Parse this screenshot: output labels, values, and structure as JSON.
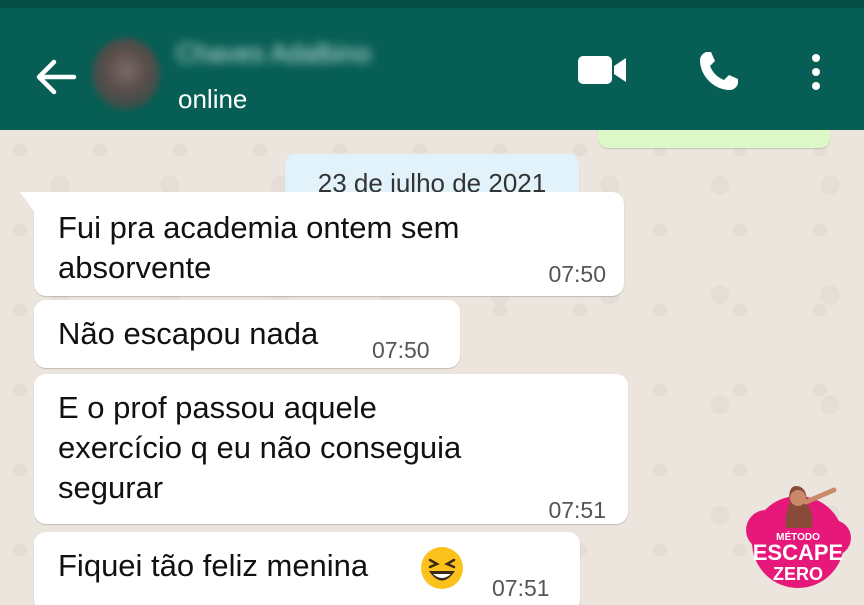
{
  "header": {
    "contact_name": "Chaves Adalbino",
    "status": "online",
    "icons": [
      "back-arrow-icon",
      "video-call-icon",
      "phone-icon",
      "more-menu-icon"
    ]
  },
  "chat": {
    "date_chip": "23 de julho de 2021",
    "messages": [
      {
        "text": "Fui pra academia ontem sem\nabsorvente",
        "time": "07:50"
      },
      {
        "text": "Não escapou nada",
        "time": "07:50"
      },
      {
        "text": "E o prof passou aquele\nexercício q eu não conseguia\nsegurar",
        "time": "07:51"
      },
      {
        "text": "Fiquei tão feliz menina",
        "time": "07:51",
        "emoji": "laughing-face-icon"
      }
    ]
  },
  "watermark": {
    "line1": "MÉTODO",
    "line2": "ESCAPE",
    "line3": "ZERO"
  },
  "colors": {
    "header": "#075e54",
    "incoming_bubble": "#ffffff",
    "outgoing_bubble": "#dcf8c6",
    "date_chip": "#e1f2fb",
    "logo_pink": "#e6197a"
  }
}
